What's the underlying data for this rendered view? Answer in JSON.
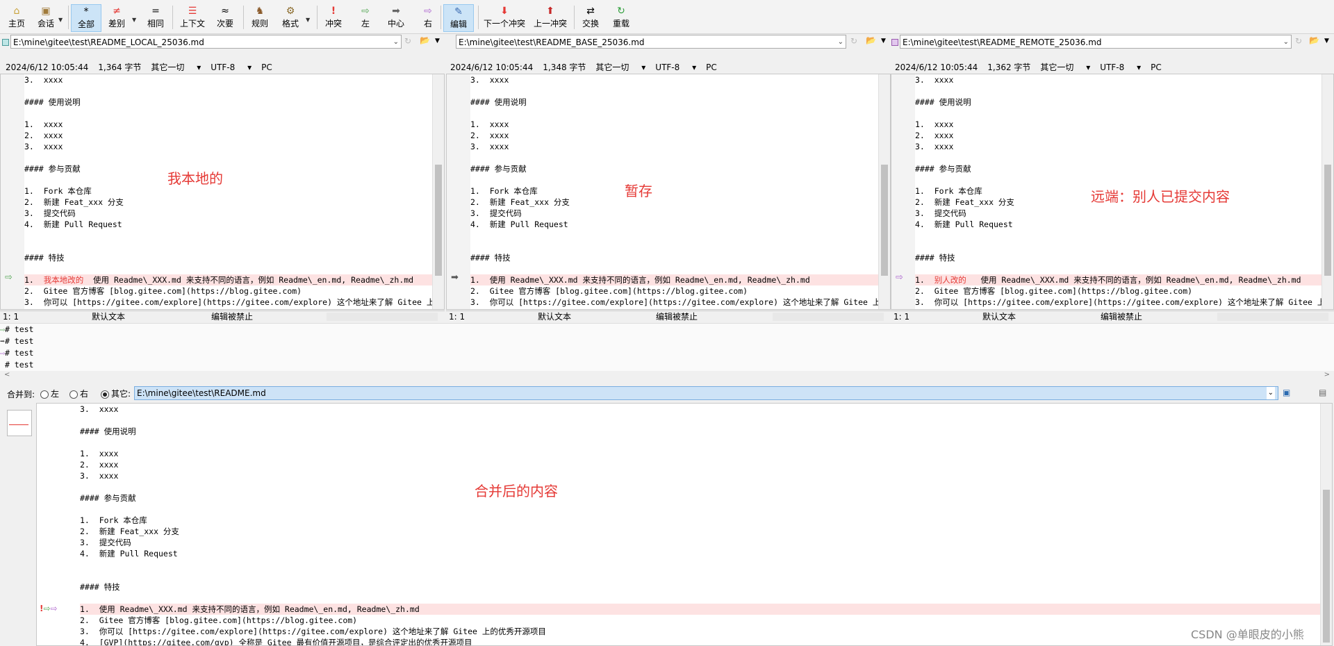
{
  "toolbar": {
    "buttons": [
      {
        "label": "主页",
        "icon": "home-icon"
      },
      {
        "label": "会话",
        "icon": "session-icon"
      },
      {
        "label": "全部",
        "icon": "all-icon"
      },
      {
        "label": "差别",
        "icon": "diff-icon"
      },
      {
        "label": "相同",
        "icon": "same-icon"
      },
      {
        "label": "上下文",
        "icon": "context-icon"
      },
      {
        "label": "次要",
        "icon": "minor-icon"
      },
      {
        "label": "规则",
        "icon": "rules-icon"
      },
      {
        "label": "格式",
        "icon": "format-icon"
      },
      {
        "label": "冲突",
        "icon": "conflict-icon"
      },
      {
        "label": "左",
        "icon": "left-arrow-icon"
      },
      {
        "label": "中心",
        "icon": "center-arrow-icon"
      },
      {
        "label": "右",
        "icon": "right-arrow-icon"
      },
      {
        "label": "编辑",
        "icon": "edit-icon"
      },
      {
        "label": "下一个冲突",
        "icon": "next-conflict-icon"
      },
      {
        "label": "上一冲突",
        "icon": "prev-conflict-icon"
      },
      {
        "label": "交换",
        "icon": "swap-icon"
      },
      {
        "label": "重载",
        "icon": "reload-icon"
      }
    ]
  },
  "panes": [
    {
      "path": "E:\\mine\\gitee\\test\\README_LOCAL_25036.md",
      "date": "2024/6/12 10:05:44",
      "size": "1,364 字节",
      "misc": "其它一切",
      "enc": "UTF-8",
      "eol": "PC",
      "status_pos": "1: 1",
      "status_text": "默认文本",
      "status_edit": "编辑被禁止",
      "annotation": "我本地的",
      "hl_prefix": "我本地改的",
      "swatch": "#7ec8c8"
    },
    {
      "path": "E:\\mine\\gitee\\test\\README_BASE_25036.md",
      "date": "2024/6/12 10:05:44",
      "size": "1,348 字节",
      "misc": "其它一切",
      "enc": "UTF-8",
      "eol": "PC",
      "status_pos": "1: 1",
      "status_text": "默认文本",
      "status_edit": "编辑被禁止",
      "annotation": "暂存",
      "hl_prefix": "",
      "swatch": ""
    },
    {
      "path": "E:\\mine\\gitee\\test\\README_REMOTE_25036.md",
      "date": "2024/6/12 10:05:44",
      "size": "1,362 字节",
      "misc": "其它一切",
      "enc": "UTF-8",
      "eol": "PC",
      "status_pos": "1: 1",
      "status_text": "默认文本",
      "status_edit": "编辑被禁止",
      "annotation": "远端：别人已提交内容",
      "hl_prefix": "别人改的",
      "swatch": "#c79ad8"
    }
  ],
  "code_lines": [
    "3.  xxxx",
    "",
    "#### 使用说明",
    "",
    "1.  xxxx",
    "2.  xxxx",
    "3.  xxxx",
    "",
    "#### 参与贡献",
    "",
    "1.  Fork 本仓库",
    "2.  新建 Feat_xxx 分支",
    "3.  提交代码",
    "4.  新建 Pull Request",
    "",
    "",
    "#### 特技",
    ""
  ],
  "hl_line": "1.  使用 Readme\\_XXX.md 来支持不同的语言，例如 Readme\\_en.md, Readme\\_zh.md",
  "hl_line_local": "1.  我本地改的  使用 Readme\\_XXX.md 来支持不同的语言，例如 Readme\\_en.md, Readme\\_zh.md",
  "hl_line_remote": "1.  别人改的   使用 Readme\\_XXX.md 来支持不同的语言，例如 Readme\\_en.md, Readme\\_zh.md",
  "after_lines": [
    "2.  Gitee 官方博客 [blog.gitee.com](https://blog.gitee.com)",
    "3.  你可以 [https://gitee.com/explore](https://gitee.com/explore) 这个地址来了解 Gitee 上的优秀开源项目",
    "4.  [GVP](https://gitee.com/gvp) 全称是 Gitee 最有价值开源项目，是综合评定出的优秀开源项目"
  ],
  "diff_rows": [
    "# test",
    "# test",
    "# test",
    "# test"
  ],
  "merge": {
    "label": "合并到:",
    "opt_left": "左",
    "opt_right": "右",
    "opt_other": "其它:",
    "path": "E:\\mine\\gitee\\test\\README.md",
    "annotation": "合并后的内容"
  },
  "watermark": "CSDN @单眼皮的小熊"
}
